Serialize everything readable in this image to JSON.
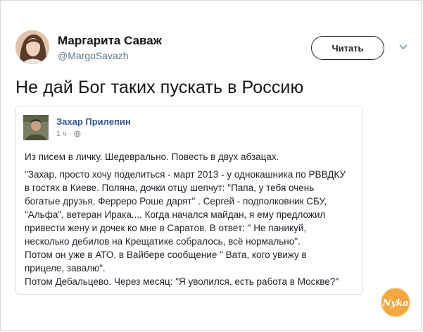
{
  "tweet": {
    "author_name": "Маргарита Саваж",
    "author_handle": "@MargoSavazh",
    "follow_label": "Читать",
    "text": "Не дай Бог таких пускать в Россию"
  },
  "embedded_post": {
    "author_name": "Захар Прилепин",
    "time": "1 ч ·",
    "intro": "Из писем в личку. Шедеврально. Повесть в двух абзацах.",
    "lines": [
      "\"Захар, просто хочу поделиться - март 2013 - у однокашника по РВВДКУ",
      "в гостях в Киеве. Поляна, дочки отцу шепчут: \"Папа, у тебя очень",
      "богатые друзья, Ферреро Роше дарят\" . Сергей - подполковник СБУ,",
      "\"Альфа\", ветеран Ирака.... Когда начался майдан, я ему предложил",
      "привести жену и дочек ко мне в Саратов. В ответ: \" Не паникуй,",
      "несколько дебилов на Крещатике собралось, всё нормально\".",
      "Потом он уже в АТО, в Вайбере сообщение \" Вата, кого увижу в",
      "прицеле, завалю\".",
      "Потом Дебальцево. Через месяц: \"Я уволился, есть работа в Москве?\""
    ]
  },
  "watermark": {
    "text": "Nyka"
  },
  "colors": {
    "fb_name": "#365899",
    "handle": "#657786",
    "watermark": "#f29a2e"
  },
  "icons": [
    "chevron-down-icon",
    "globe-icon"
  ]
}
